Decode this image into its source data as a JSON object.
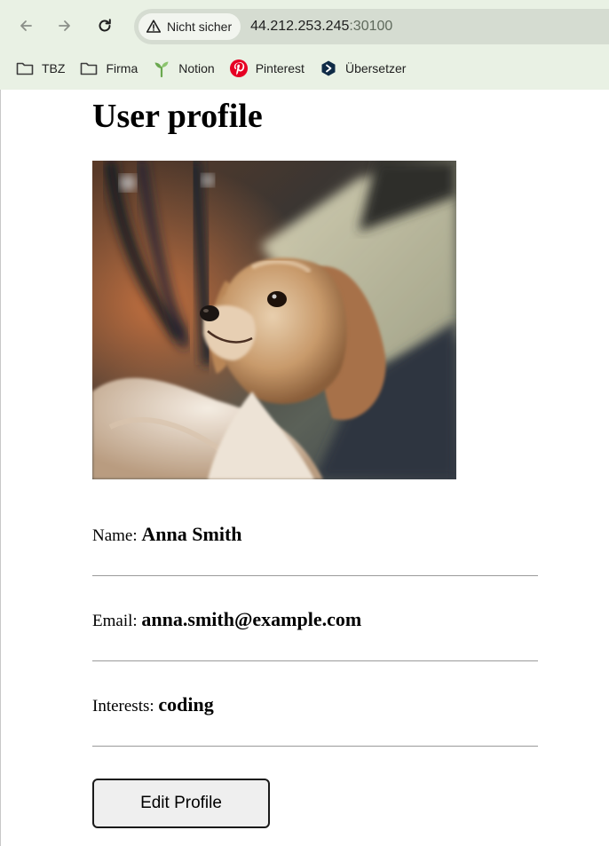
{
  "browser": {
    "security_label": "Nicht sicher",
    "url_host": "44.212.253.245",
    "url_port": ":30100",
    "bookmarks": [
      {
        "label": "TBZ",
        "icon": "folder-icon"
      },
      {
        "label": "Firma",
        "icon": "folder-icon"
      },
      {
        "label": "Notion",
        "icon": "sprout-icon"
      },
      {
        "label": "Pinterest",
        "icon": "pinterest-icon"
      },
      {
        "label": "Übersetzer",
        "icon": "translator-icon"
      }
    ]
  },
  "profile": {
    "title": "User profile",
    "photo_icon": "dog-photo",
    "fields": {
      "name": {
        "label": "Name: ",
        "value": "Anna Smith"
      },
      "email": {
        "label": "Email: ",
        "value": "anna.smith@example.com"
      },
      "interests": {
        "label": "Interests: ",
        "value": "coding"
      }
    },
    "edit_button_label": "Edit Profile"
  },
  "colors": {
    "chrome_bg": "#e9f1e4",
    "omnibox_bg": "#d5dcd1",
    "pinterest": "#e60023",
    "notion_sprout": "#6aa84f"
  }
}
